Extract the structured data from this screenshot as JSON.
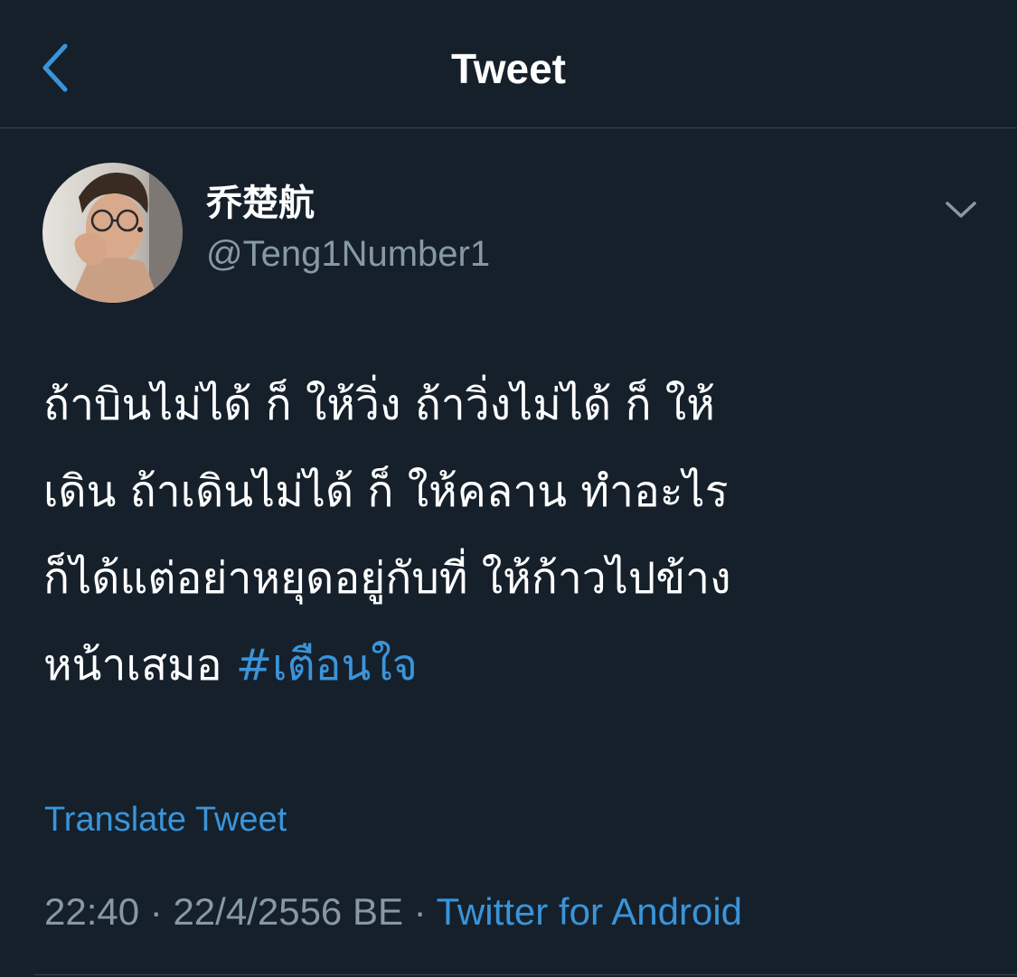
{
  "header": {
    "title": "Tweet",
    "back_icon": "chevron-left-icon"
  },
  "user": {
    "display_name": "乔楚航",
    "username": "@Teng1Number1",
    "avatar_icon": "avatar-photo"
  },
  "tweet": {
    "lines": [
      "ถ้าบินไม่ได้ ก็ ให้วิ่ง ถ้าวิ่งไม่ได้ ก็ ให้",
      "เดิน ถ้าเดินไม่ได้ ก็ ให้คลาน ทำอะไร",
      "ก็ได้แต่อย่าหยุดอยู่กับที่  ให้ก้าวไปข้าง"
    ],
    "last_line_text": "หน้าเสมอ ",
    "hashtag": "#เตือนใจ",
    "translate_label": "Translate Tweet"
  },
  "meta": {
    "time": "22:40",
    "separator": " · ",
    "date": "22/4/2556 BE",
    "separator2": " · ",
    "source": "Twitter for Android"
  },
  "colors": {
    "background": "#15202b",
    "accent": "#3b94d9",
    "secondary_text": "#8899a6",
    "divider": "#38444d"
  }
}
